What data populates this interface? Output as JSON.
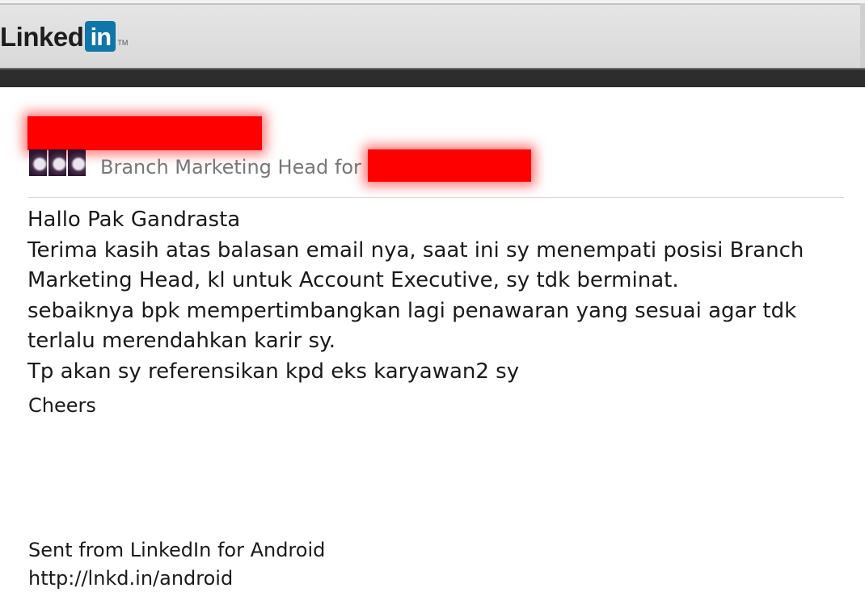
{
  "header": {
    "logo_word": "Linked",
    "logo_box": "in",
    "logo_tm": "TM"
  },
  "sender": {
    "title": "Branch Marketing Head for"
  },
  "message": {
    "lines": [
      "Hallo Pak Gandrasta",
      "Terima kasih atas balasan email nya, saat ini sy menempati posisi Branch Marketing Head, kl untuk Account Executive, sy tdk berminat.",
      "sebaiknya bpk mempertimbangkan lagi penawaran yang sesuai agar tdk terlalu merendahkan karir sy.",
      "Tp akan sy referensikan kpd eks karyawan2 sy"
    ],
    "signoff": "Cheers"
  },
  "footer": {
    "sent_from": "Sent from LinkedIn for Android",
    "link": "http://lnkd.in/android"
  },
  "colors": {
    "brand_blue": "#0e76a8",
    "redaction": "#ff0000",
    "dark_bar": "#2d2d2d"
  }
}
